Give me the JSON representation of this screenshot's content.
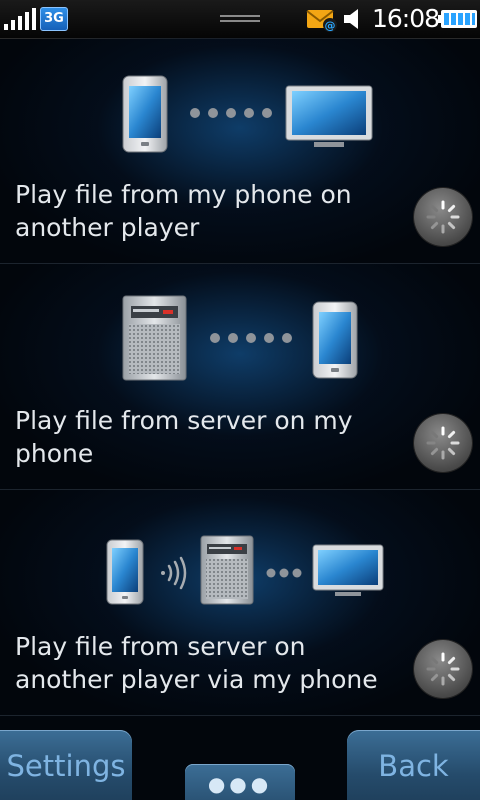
{
  "status_bar": {
    "network": "3G",
    "time": "16:08",
    "icons": [
      "signal-icon",
      "network-3g-icon",
      "drag-handle-icon",
      "new-email-icon",
      "speaker-icon",
      "battery-icon"
    ]
  },
  "options": [
    {
      "label": "Play file from my phone on another player",
      "illustration": [
        "phone-icon",
        "dots-connector-icon",
        "tv-icon"
      ]
    },
    {
      "label": "Play file from server on my phone",
      "illustration": [
        "server-icon",
        "dots-connector-icon",
        "phone-icon"
      ]
    },
    {
      "label": "Play file from server on another player via my phone",
      "illustration": [
        "phone-icon",
        "wireless-icon",
        "server-icon",
        "dots-connector-icon",
        "tv-icon"
      ]
    }
  ],
  "bottom_bar": {
    "settings_label": "Settings",
    "back_label": "Back",
    "more_label": "●●●"
  },
  "colors": {
    "background": "#02060c",
    "glow": "#114678",
    "softkey": "#2c587c",
    "softkey_text": "#7fb4e2",
    "label_text": "#e4e8ec"
  }
}
